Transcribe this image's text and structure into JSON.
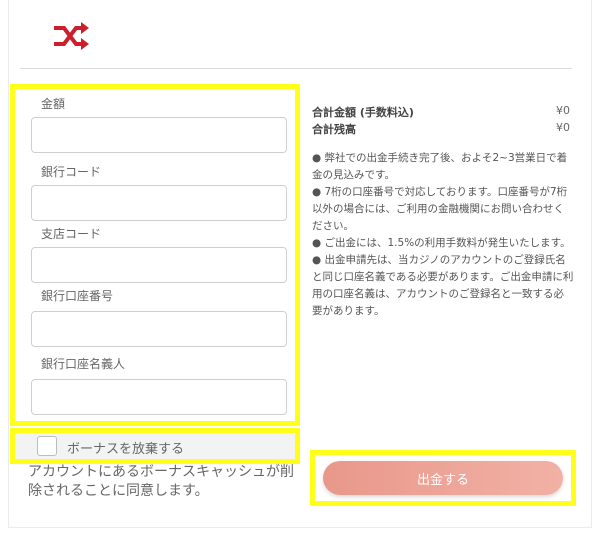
{
  "fields": [
    {
      "label": "金額",
      "value": ""
    },
    {
      "label": "銀行コード",
      "value": ""
    },
    {
      "label": "支店コード",
      "value": ""
    },
    {
      "label": "銀行口座番号",
      "value": ""
    },
    {
      "label": "銀行口座名義人",
      "value": ""
    }
  ],
  "bonus": {
    "checked": false,
    "label": "ボーナスを放棄する",
    "note": "アカウントにあるボーナスキャッシュが削除されることに同意します。"
  },
  "summary": {
    "total_label": "合計金額 (手数料込)",
    "total_value": "¥0",
    "balance_label": "合計残高",
    "balance_value": "¥0"
  },
  "notes": [
    "● 弊社での出金手続き完了後、およそ2~3営業日で着金の見込みです。",
    "● 7桁の口座番号で対応しております。口座番号が7桁以外の場合には、ご利用の金融機関にお問い合わせください。",
    "● ご出金には、1.5%の利用手数料が発生いたします。",
    "● 出金申請先は、当カジノのアカウントのご登録氏名と同じ口座名義である必要があります。ご出金申請に利用の口座名義は、アカウントのご登録名と一致する必要があります。"
  ],
  "submit_label": "出金する",
  "colors": {
    "highlight": "#ffff1a",
    "logo": "#cc1f2e",
    "button": "#eea296"
  },
  "logo_icon": "shuffle-icon"
}
